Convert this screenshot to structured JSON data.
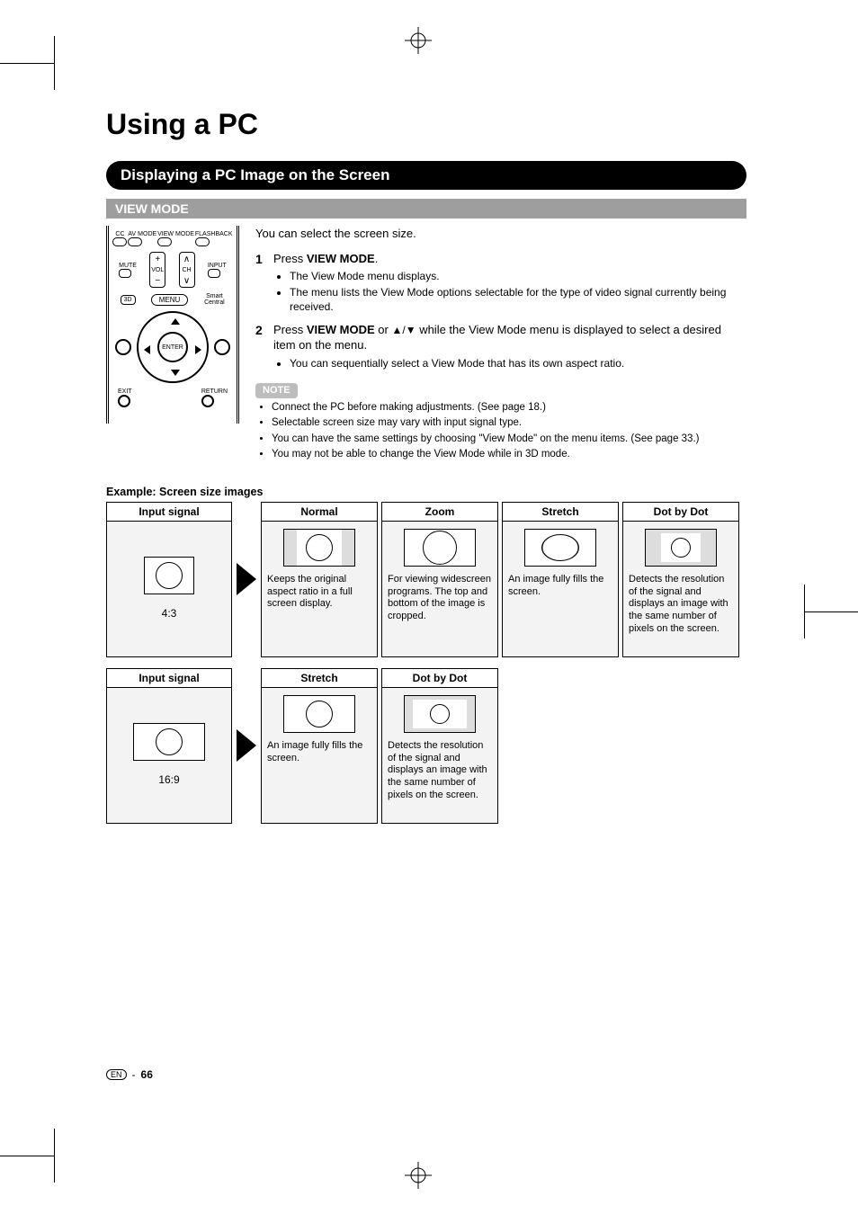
{
  "title": "Using a PC",
  "section_heading": "Displaying a PC Image on the Screen",
  "subsection": "VIEW MODE",
  "intro": "You can select the screen size.",
  "steps": {
    "s1_num": "1",
    "s1_text_a": "Press ",
    "s1_text_b": "VIEW MODE",
    "s1_text_c": ".",
    "s1_bullets": [
      "The View Mode menu displays.",
      "The menu lists the View Mode options selectable for the type of video signal currently being received."
    ],
    "s2_num": "2",
    "s2_text_a": "Press ",
    "s2_text_b": "VIEW MODE",
    "s2_text_c": " or ",
    "s2_text_d": " while the View Mode menu is displayed to select a desired item on the menu.",
    "s2_bullets": [
      "You can sequentially select a View Mode that has its own aspect ratio."
    ]
  },
  "note_label": "NOTE",
  "notes": [
    "Connect the PC before making adjustments. (See page 18.)",
    "Selectable screen size may vary with input signal type.",
    "You can have the same settings by choosing \"View Mode\" on the menu items. (See page 33.)",
    "You may not be able to change the View Mode while in 3D mode."
  ],
  "example_title": "Example: Screen size images",
  "row1": {
    "input_head": "Input signal",
    "input_label": "4:3",
    "cells": [
      {
        "head": "Normal",
        "desc": "Keeps the original aspect ratio in a full screen display."
      },
      {
        "head": "Zoom",
        "desc": "For viewing widescreen programs. The top and bottom of the image is cropped."
      },
      {
        "head": "Stretch",
        "desc": "An image fully fills the screen."
      },
      {
        "head": "Dot by Dot",
        "desc": "Detects the resolution of the signal and displays an image with the same number of pixels on the screen."
      }
    ]
  },
  "row2": {
    "input_head": "Input signal",
    "input_label": "16:9",
    "cells": [
      {
        "head": "Stretch",
        "desc": "An image fully fills the screen."
      },
      {
        "head": "Dot by Dot",
        "desc": "Detects the resolution of the signal and displays an image with the same number of pixels on the screen."
      }
    ]
  },
  "remote": {
    "top_labels": [
      "CC",
      "AV MODE",
      "VIEW MODE",
      "FLASHBACK"
    ],
    "mute": "MUTE",
    "vol": "VOL",
    "ch": "CH",
    "input": "INPUT",
    "d3": "3D",
    "menu": "MENU",
    "smart": "Smart Central",
    "enter": "ENTER",
    "exit": "EXIT",
    "ret": "RETURN"
  },
  "footer": {
    "lang": "EN",
    "sep": "-",
    "page": "66"
  }
}
